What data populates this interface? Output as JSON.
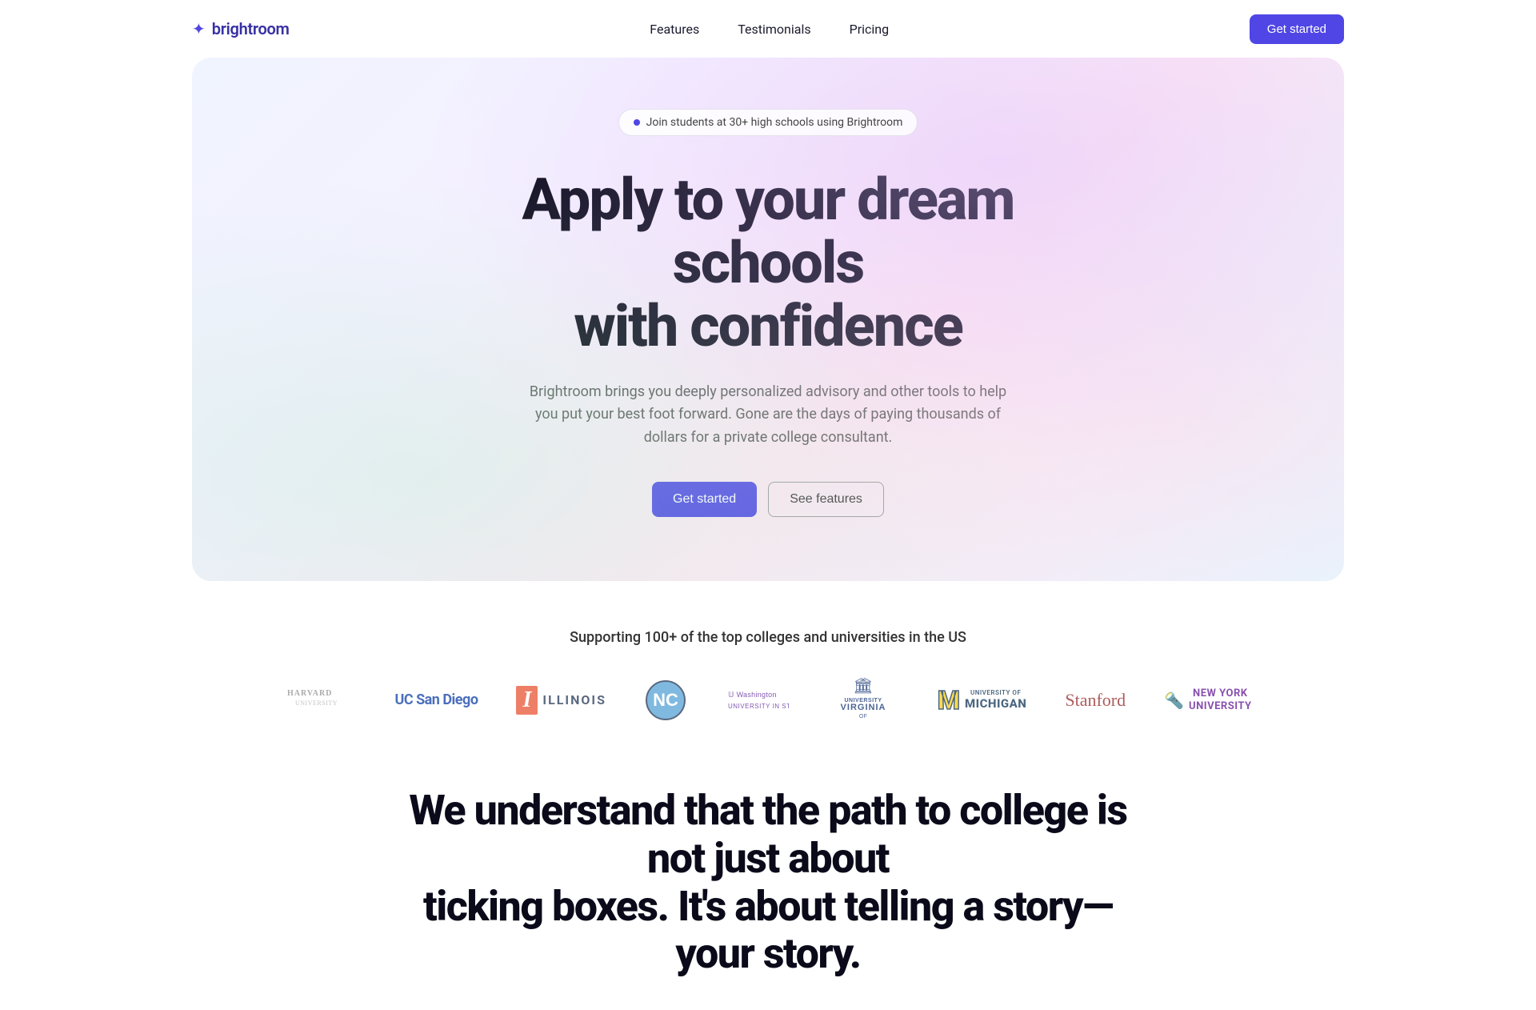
{
  "brand": {
    "logo_text": "brightroom",
    "logo_icon": "✦"
  },
  "navbar": {
    "links": [
      {
        "label": "Features",
        "id": "features"
      },
      {
        "label": "Testimonials",
        "id": "testimonials"
      },
      {
        "label": "Pricing",
        "id": "pricing"
      }
    ],
    "cta_label": "Get started"
  },
  "hero": {
    "badge_text": "Join students at 30+ high schools using Brightroom",
    "title_line1": "Apply to your dream schools",
    "title_line2": "with confidence",
    "subtitle": "Brightroom brings you deeply personalized advisory and other tools to help you put your best foot forward. Gone are the days of paying thousands of dollars for a private college consultant.",
    "cta_primary": "Get started",
    "cta_secondary": "See features"
  },
  "universities": {
    "section_title": "Supporting 100+ of the top colleges and universities in the US",
    "logos": [
      {
        "name": "Harvard University",
        "id": "harvard"
      },
      {
        "name": "UC San Diego",
        "id": "ucsd"
      },
      {
        "name": "University of Illinois",
        "id": "illinois"
      },
      {
        "name": "UNC Chapel Hill",
        "id": "unc"
      },
      {
        "name": "University of Washington",
        "id": "washington"
      },
      {
        "name": "University of Virginia",
        "id": "uva"
      },
      {
        "name": "University of Michigan",
        "id": "michigan"
      },
      {
        "name": "Stanford University",
        "id": "stanford"
      },
      {
        "name": "New York University",
        "id": "nyu"
      }
    ]
  },
  "bottom": {
    "title_line1": "We understand that the path to college is not just about",
    "title_line2": "ticking boxes. It's about telling a story—your story."
  }
}
